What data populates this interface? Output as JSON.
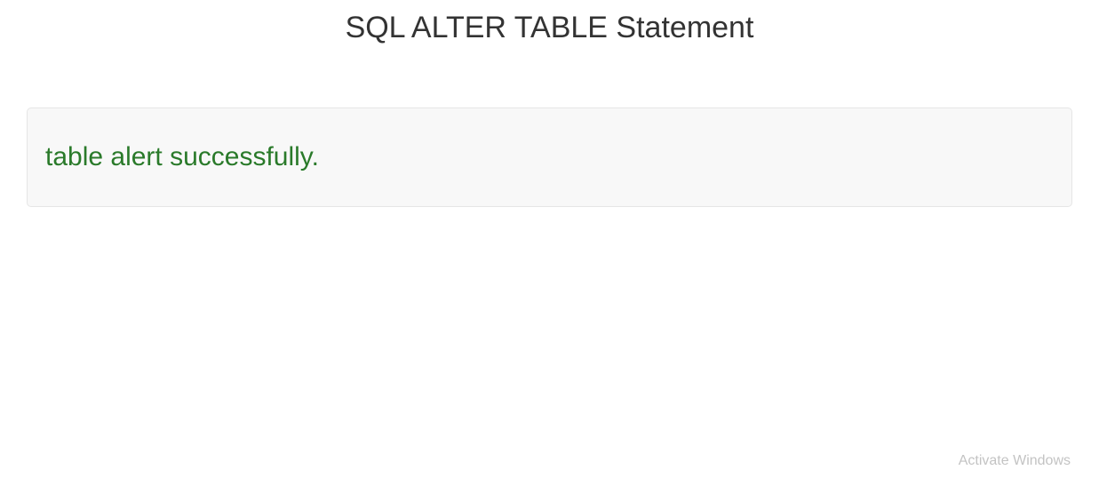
{
  "page": {
    "title": "SQL ALTER TABLE Statement"
  },
  "message": {
    "text": "table alert successfully."
  },
  "watermark": {
    "text": "Activate Windows"
  }
}
